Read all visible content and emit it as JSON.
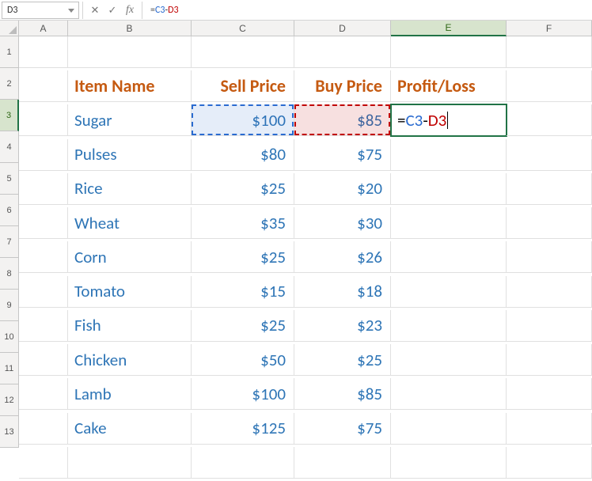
{
  "formula_bar": {
    "name_box": "D3",
    "formula_eq": "=",
    "formula_c3": "C3",
    "formula_minus": "-",
    "formula_d3": "D3"
  },
  "column_headers": [
    "A",
    "B",
    "C",
    "D",
    "E",
    "F"
  ],
  "row_headers": [
    "1",
    "2",
    "3",
    "4",
    "5",
    "6",
    "7",
    "8",
    "9",
    "10",
    "11",
    "12",
    "13"
  ],
  "headers": {
    "item": "Item Name",
    "sell": "Sell Price",
    "buy": "Buy Price",
    "pl": "Profit/Loss"
  },
  "rows": [
    {
      "item": "Sugar",
      "sell": "$100",
      "buy": "$85"
    },
    {
      "item": "Pulses",
      "sell": "$80",
      "buy": "$75"
    },
    {
      "item": "Rice",
      "sell": "$25",
      "buy": "$20"
    },
    {
      "item": "Wheat",
      "sell": "$35",
      "buy": "$30"
    },
    {
      "item": "Corn",
      "sell": "$25",
      "buy": "$26"
    },
    {
      "item": "Tomato",
      "sell": "$15",
      "buy": "$18"
    },
    {
      "item": "Fish",
      "sell": "$25",
      "buy": "$23"
    },
    {
      "item": "Chicken",
      "sell": "$50",
      "buy": "$25"
    },
    {
      "item": "Lamb",
      "sell": "$100",
      "buy": "$85"
    },
    {
      "item": "Cake",
      "sell": "$125",
      "buy": "$75"
    }
  ],
  "e3_formula": {
    "eq": "=",
    "c3": "C3",
    "minus": "-",
    "d3": "D3"
  }
}
